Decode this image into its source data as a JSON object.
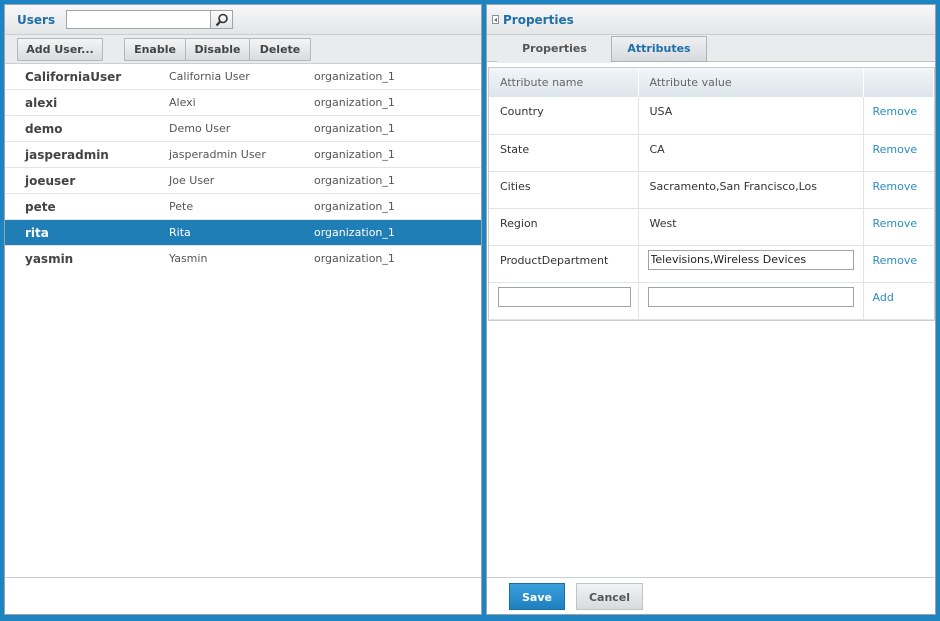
{
  "users_panel": {
    "title": "Users",
    "search": {
      "value": "",
      "placeholder": ""
    },
    "toolbar": {
      "add_label": "Add User...",
      "enable_label": "Enable",
      "disable_label": "Disable",
      "delete_label": "Delete"
    },
    "users": [
      {
        "name": "CaliforniaUser",
        "full_name": "California User",
        "org": "organization_1",
        "selected": false
      },
      {
        "name": "alexi",
        "full_name": "Alexi",
        "org": "organization_1",
        "selected": false
      },
      {
        "name": "demo",
        "full_name": "Demo User",
        "org": "organization_1",
        "selected": false
      },
      {
        "name": "jasperadmin",
        "full_name": "jasperadmin User",
        "org": "organization_1",
        "selected": false
      },
      {
        "name": "joeuser",
        "full_name": "Joe User",
        "org": "organization_1",
        "selected": false
      },
      {
        "name": "pete",
        "full_name": "Pete",
        "org": "organization_1",
        "selected": false
      },
      {
        "name": "rita",
        "full_name": "Rita",
        "org": "organization_1",
        "selected": true
      },
      {
        "name": "yasmin",
        "full_name": "Yasmin",
        "org": "organization_1",
        "selected": false
      }
    ]
  },
  "properties_panel": {
    "title": "Properties",
    "tabs": [
      {
        "label": "Properties",
        "active": false
      },
      {
        "label": "Attributes",
        "active": true
      }
    ],
    "table": {
      "headers": {
        "name": "Attribute name",
        "value": "Attribute value"
      },
      "rows": [
        {
          "name": "Country",
          "value": "USA",
          "action": "Remove",
          "editing": false
        },
        {
          "name": "State",
          "value": "CA",
          "action": "Remove",
          "editing": false
        },
        {
          "name": "Cities",
          "value": "Sacramento,San Francisco,Los",
          "action": "Remove",
          "editing": false
        },
        {
          "name": "Region",
          "value": "West",
          "action": "Remove",
          "editing": false
        },
        {
          "name": "ProductDepartment",
          "value": "Televisions,Wireless Devices",
          "action": "Remove",
          "editing": true
        }
      ],
      "new_row": {
        "name_value": "",
        "value_value": "",
        "action": "Add"
      }
    },
    "footer": {
      "save_label": "Save",
      "cancel_label": "Cancel"
    }
  },
  "colors": {
    "frame": "#1d84c1",
    "accent": "#1f6fa8",
    "selected_row": "#1f7eb5",
    "link": "#2a8cc4",
    "save_button": "#2a90d0"
  }
}
